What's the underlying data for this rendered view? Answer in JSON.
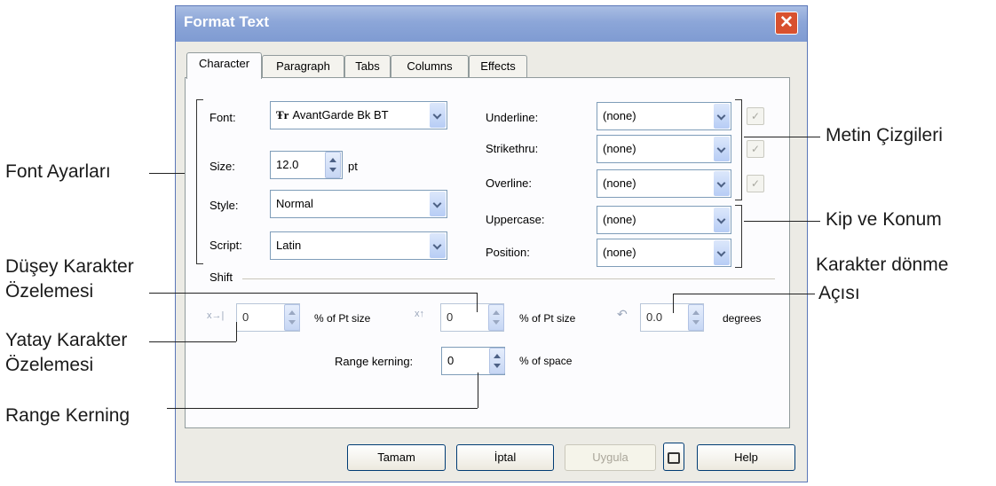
{
  "dialog": {
    "title": "Format Text",
    "tabs": [
      "Character",
      "Paragraph",
      "Tabs",
      "Columns",
      "Effects"
    ]
  },
  "font_settings": {
    "font_label": "Font:",
    "font_value": "AvantGarde Bk BT",
    "font_icon_glyph": "Ŧr",
    "size_label": "Size:",
    "size_value": "12.0",
    "size_unit": "pt",
    "style_label": "Style:",
    "style_value": "Normal",
    "script_label": "Script:",
    "script_value": "Latin"
  },
  "line_settings": {
    "underline_label": "Underline:",
    "underline_value": "(none)",
    "strikethru_label": "Strikethru:",
    "strikethru_value": "(none)",
    "overline_label": "Overline:",
    "overline_value": "(none)",
    "uppercase_label": "Uppercase:",
    "uppercase_value": "(none)",
    "position_label": "Position:",
    "position_value": "(none)"
  },
  "shift": {
    "section_label": "Shift",
    "horizontal_value": "0",
    "horizontal_unit": "% of Pt size",
    "vertical_value": "0",
    "vertical_unit": "% of Pt size",
    "angle_value": "0.0",
    "angle_unit": "degrees",
    "range_kerning_label": "Range kerning:",
    "range_kerning_value": "0",
    "range_kerning_unit": "% of space"
  },
  "buttons": {
    "ok": "Tamam",
    "cancel": "İptal",
    "apply": "Uygula",
    "help": "Help"
  },
  "annotations": {
    "font_settings": "Font Ayarları",
    "text_lines": "Metin Çizgileri",
    "mode_position": "Kip ve Konum",
    "vertical_shift_1": "Düşey Karakter",
    "vertical_shift_2": "Özelemesi",
    "horizontal_shift_1": "Yatay Karakter",
    "horizontal_shift_2": "Özelemesi",
    "rotation_1": "Karakter dönme",
    "rotation_2": "Açısı",
    "range_kerning": "Range Kerning"
  },
  "colors": {
    "title_bar": "#8ca6d8",
    "close_button": "#d8512f",
    "dialog_bg": "#ecebe5",
    "tab_panel": "#fcfcfe"
  },
  "icons": [
    "font-type-icon",
    "close-icon",
    "chevron-down-icon",
    "spin-arrows-icon",
    "checkbox-icon",
    "lock-icon",
    "horizontal-shift-icon",
    "vertical-shift-icon",
    "rotation-icon"
  ]
}
